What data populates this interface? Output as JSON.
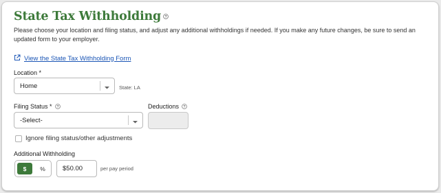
{
  "header": {
    "title": "State Tax Withholding",
    "help_icon": "question-circle-icon",
    "description": "Please choose your location and filing status, and adjust any additional withholdings if needed. If you make any future changes, be sure to send an updated form to your employer."
  },
  "form_link": {
    "icon": "external-link-icon",
    "label": "View the State Tax Withholding Form"
  },
  "location": {
    "label": "Location *",
    "value": "Home",
    "state_note": "State: LA"
  },
  "filing_status": {
    "label": "Filing Status *",
    "value": "-Select-"
  },
  "deductions": {
    "label": "Deductions",
    "value": ""
  },
  "ignore_adjustments": {
    "label": "Ignore filing status/other adjustments",
    "checked": false
  },
  "additional_withholding": {
    "label": "Additional Withholding",
    "mode_dollar": "$",
    "mode_percent": "%",
    "selected_mode": "$",
    "amount": "$50.00",
    "suffix": "per pay period"
  },
  "colors": {
    "accent": "#3d7a3a",
    "link": "#1a55b5"
  }
}
